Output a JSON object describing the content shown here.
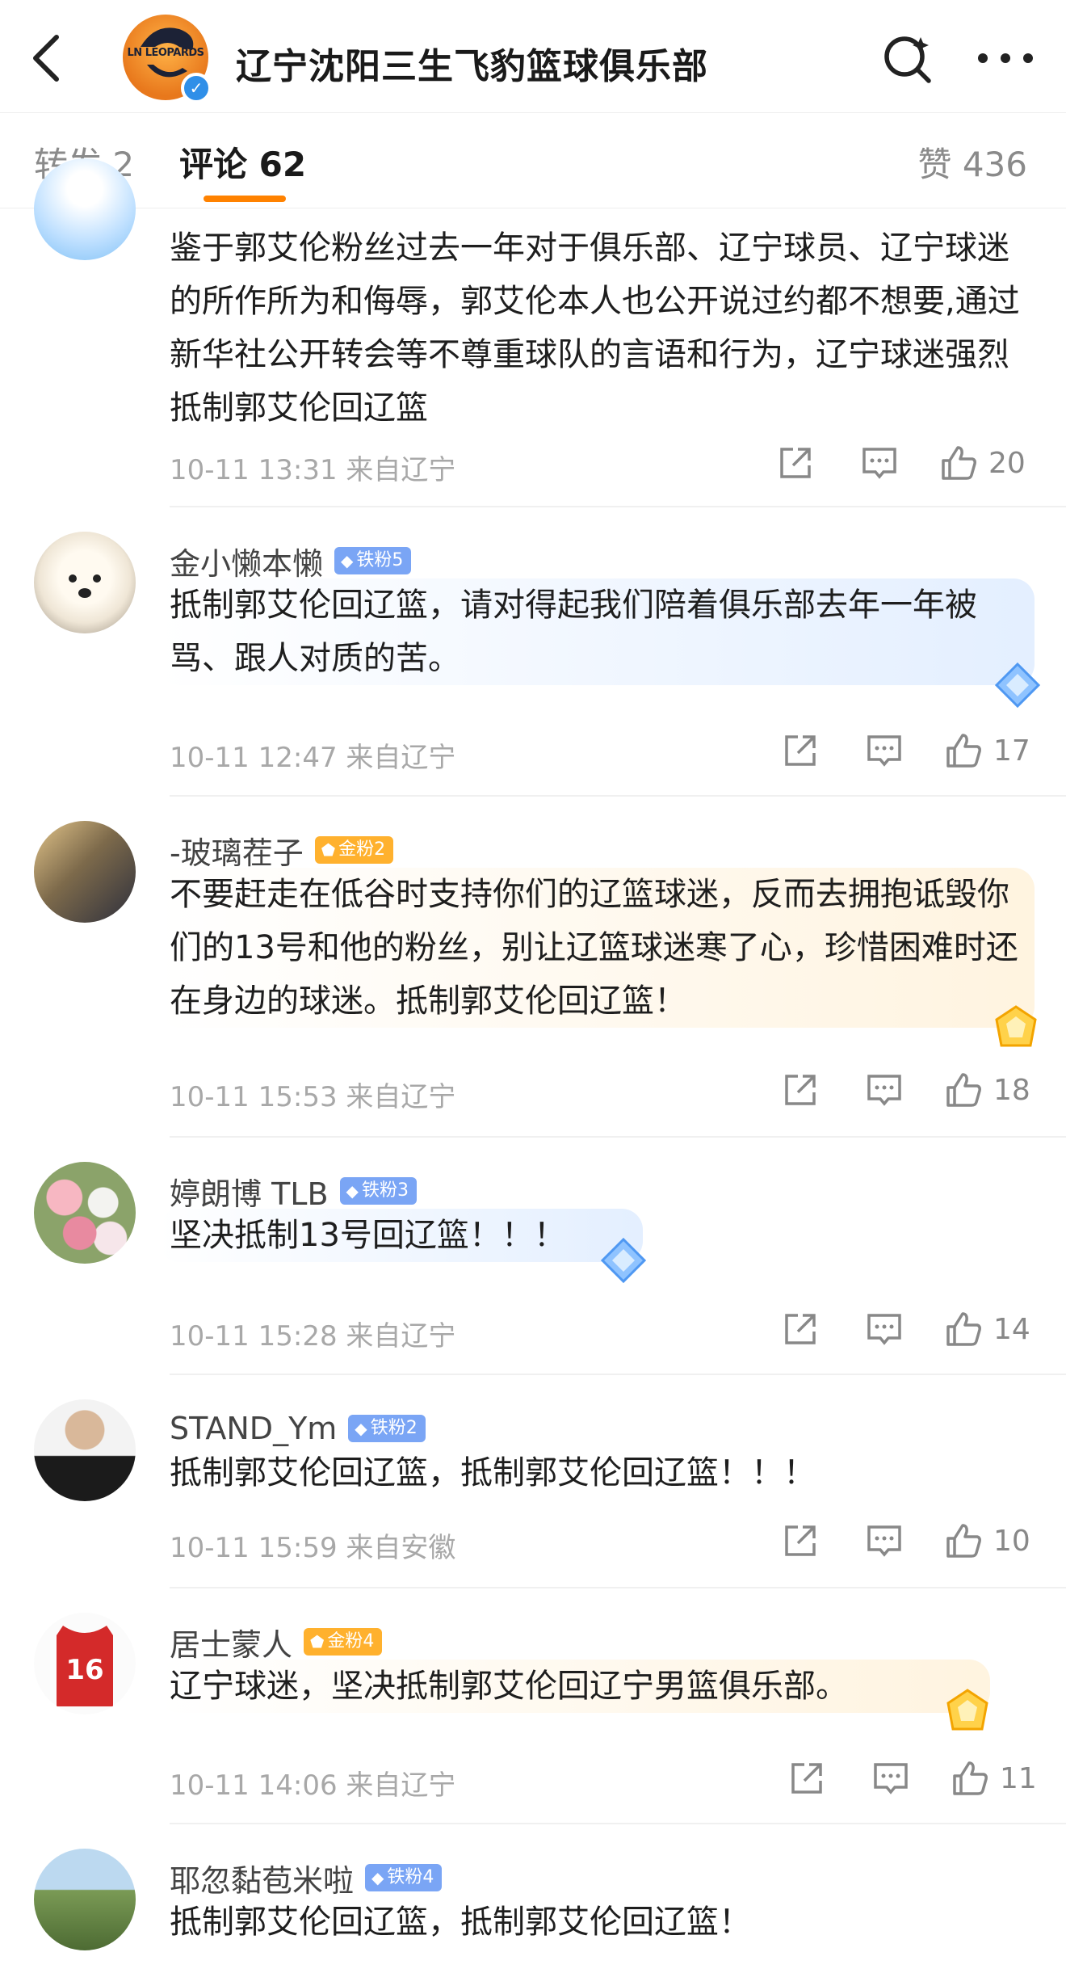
{
  "header": {
    "title": "辽宁沈阳三生飞豹篮球俱乐部",
    "avatar_logo_text": "LN LEOPARDS"
  },
  "tabs": {
    "reposts": "转发 2",
    "comments": "评论 62",
    "likes": "赞 436"
  },
  "comments": [
    {
      "name": "",
      "badge": "",
      "text": "鉴于郭艾伦粉丝过去一年对于俱乐部、辽宁球员、辽宁球迷的所作所为和侮辱，郭艾伦本人也公开说过约都不想要,通过新华社公开转会等不尊重球队的言语和行为，辽宁球迷强烈抵制郭艾伦回辽篮",
      "time": "10-11 13:31 来自辽宁",
      "likes": "20"
    },
    {
      "name": "金小懒本懒",
      "badge": "铁粉5",
      "text": "抵制郭艾伦回辽篮，请对得起我们陪着俱乐部去年一年被骂、跟人对质的苦。",
      "time": "10-11 12:47 来自辽宁",
      "likes": "17"
    },
    {
      "name": "-玻璃茬子",
      "badge": "金粉2",
      "text": "不要赶走在低谷时支持你们的辽篮球迷，反而去拥抱诋毁你们的13号和他的粉丝，别让辽篮球迷寒了心，珍惜困难时还在身边的球迷。抵制郭艾伦回辽篮！",
      "time": "10-11 15:53 来自辽宁",
      "likes": "18"
    },
    {
      "name": "婷朗博 TLB",
      "badge": "铁粉3",
      "text": "坚决抵制13号回辽篮！！！",
      "time": "10-11 15:28 来自辽宁",
      "likes": "14"
    },
    {
      "name": "STAND_Ym",
      "badge": "铁粉2",
      "text": "抵制郭艾伦回辽篮，抵制郭艾伦回辽篮！！！",
      "time": "10-11 15:59 来自安徽",
      "likes": "10"
    },
    {
      "name": "居士蒙人",
      "badge": "金粉4",
      "text": "辽宁球迷，坚决抵制郭艾伦回辽宁男篮俱乐部。",
      "time": "10-11 14:06 来自辽宁",
      "likes": "11"
    },
    {
      "name": "耶忽黏苞米啦",
      "badge": "铁粉4",
      "text": "抵制郭艾伦回辽篮，抵制郭艾伦回辽篮！",
      "time": "",
      "likes": ""
    }
  ],
  "colors": {
    "accent": "#ff8200",
    "iron_badge": "#7aa5f5",
    "gold_badge": "#ffb12e",
    "verified": "#2f8fe8"
  },
  "icons": [
    "back-arrow-icon",
    "search-icon",
    "more-icon",
    "share-icon",
    "comment-icon",
    "like-icon",
    "diamond-icon",
    "gold-gem-icon",
    "verified-icon"
  ]
}
